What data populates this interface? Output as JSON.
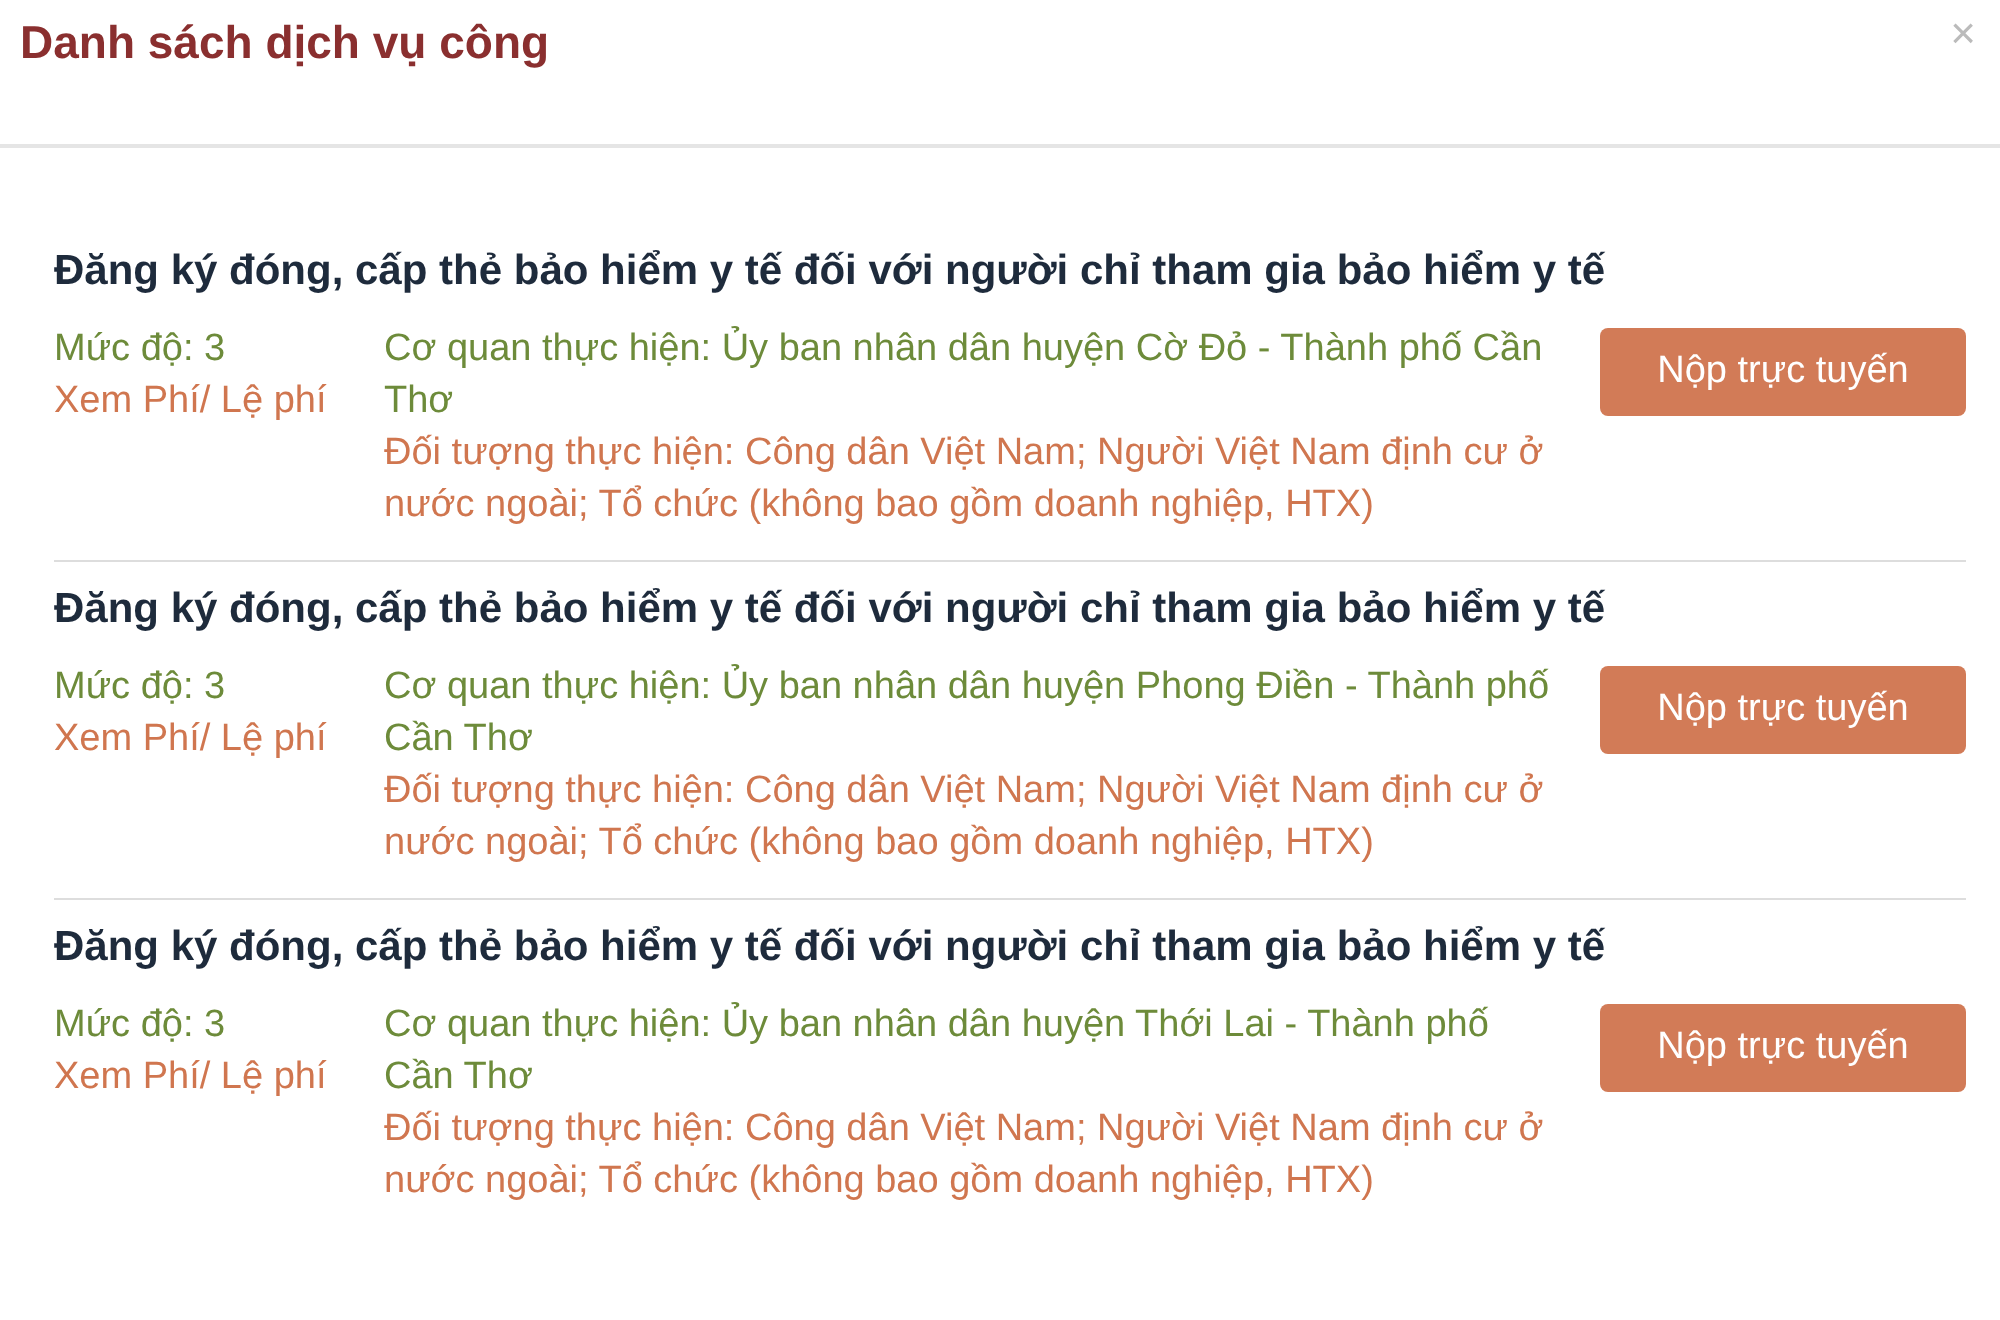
{
  "dialog": {
    "title": "Danh sách dịch vụ công",
    "close": "×"
  },
  "services": [
    {
      "title": "Đăng ký đóng, cấp thẻ bảo hiểm y tế đối với người chỉ tham gia bảo hiểm y tế",
      "level": "Mức độ: 3",
      "fee_link": "Xem Phí/ Lệ phí",
      "agency": "Cơ quan thực hiện: Ủy ban nhân dân huyện Cờ Đỏ - Thành phố Cần Thơ",
      "subjects": "Đối tượng thực hiện: Công dân Việt Nam; Người Việt Nam định cư ở nước ngoài; Tổ chức (không bao gồm doanh nghiệp, HTX)",
      "button": "Nộp trực tuyến"
    },
    {
      "title": "Đăng ký đóng, cấp thẻ bảo hiểm y tế đối với người chỉ tham gia bảo hiểm y tế",
      "level": "Mức độ: 3",
      "fee_link": "Xem Phí/ Lệ phí",
      "agency": "Cơ quan thực hiện: Ủy ban nhân dân huyện Phong Điền - Thành phố Cần Thơ",
      "subjects": "Đối tượng thực hiện: Công dân Việt Nam; Người Việt Nam định cư ở nước ngoài; Tổ chức (không bao gồm doanh nghiệp, HTX)",
      "button": "Nộp trực tuyến"
    },
    {
      "title": "Đăng ký đóng, cấp thẻ bảo hiểm y tế đối với người chỉ tham gia bảo hiểm y tế",
      "level": "Mức độ: 3",
      "fee_link": "Xem Phí/ Lệ phí",
      "agency": "Cơ quan thực hiện: Ủy ban nhân dân huyện Thới Lai - Thành phố Cần Thơ",
      "subjects": "Đối tượng thực hiện: Công dân Việt Nam; Người Việt Nam định cư ở nước ngoài; Tổ chức (không bao gồm doanh nghiệp, HTX)",
      "button": "Nộp trực tuyến"
    }
  ]
}
